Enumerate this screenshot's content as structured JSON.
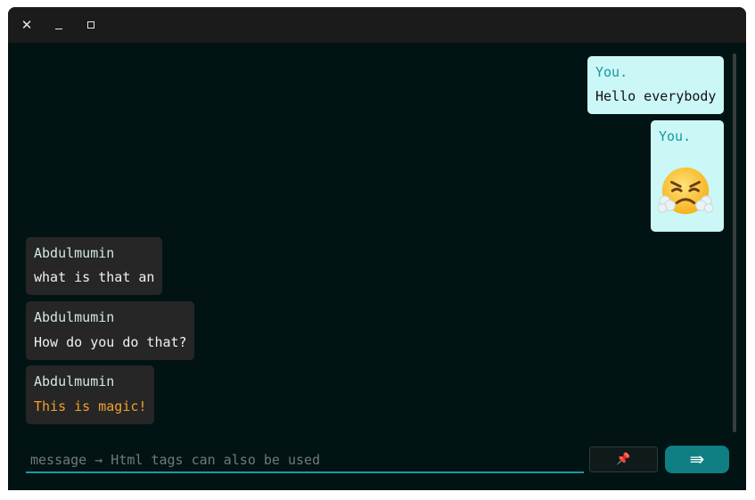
{
  "titlebar": {
    "close_glyph": "✕",
    "minimize_icon": "minimize-icon",
    "maximize_icon": "maximize-icon"
  },
  "messages": [
    {
      "sender": "You.",
      "text": "Hello everybody",
      "side": "right"
    },
    {
      "sender": "You.",
      "text": "",
      "emoji": "steam-from-nose-face",
      "side": "right"
    },
    {
      "sender": "Abdulmumin",
      "text": "what is that an",
      "side": "left"
    },
    {
      "sender": "Abdulmumin",
      "text": "How do you do that?",
      "side": "left"
    },
    {
      "sender": "Abdulmumin",
      "text": "This is magic!",
      "side": "left",
      "color": "#f0a12b"
    }
  ],
  "composer": {
    "placeholder": "message → Html tags can also be used",
    "pin_glyph": "📌",
    "send_glyph": "⇛"
  },
  "colors": {
    "background": "#021313",
    "my_bubble": "#ccf7f7",
    "their_bubble": "#262626",
    "accent": "#0f7f83"
  }
}
